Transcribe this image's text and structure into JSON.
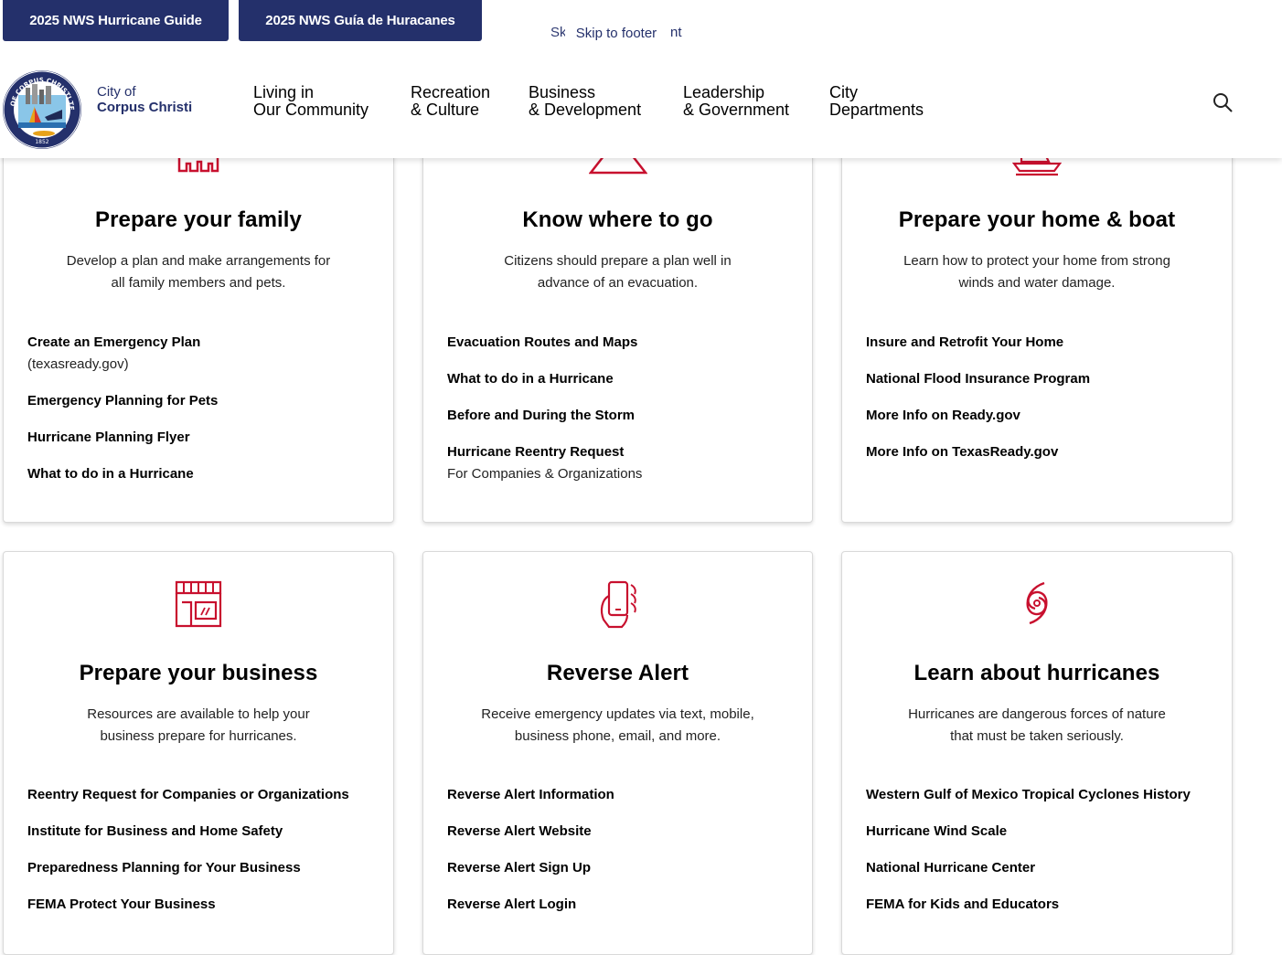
{
  "top_bar": {
    "guide_en": "2025 NWS Hurricane Guide",
    "guide_es": "2025 NWS Guía de Huracanes",
    "skip_front": "Skip to footer",
    "skip_back_left": "Sk",
    "skip_back_right": "nt"
  },
  "header": {
    "seal_text": "CITY OF CORPUS CHRISTI TEXAS",
    "seal_year": "1852",
    "brand_prefix": "City of",
    "brand_name": "Corpus Christi",
    "nav": [
      {
        "label": "Living in\nOur Community"
      },
      {
        "label": "Recreation\n& Culture"
      },
      {
        "label": "Business\n& Development"
      },
      {
        "label": "Leadership\n& Government"
      },
      {
        "label": "City\nDepartments"
      }
    ],
    "search_icon": "search-icon"
  },
  "colors": {
    "navy": "#24306b",
    "icon_red": "#c8102e"
  },
  "cards": [
    {
      "icon": "family-icon",
      "title": "Prepare your family",
      "desc": "Develop a plan and make arrangements for all family members and pets.",
      "links": [
        {
          "title": "Create an Emergency Plan",
          "sub": "(texasready.gov)"
        },
        {
          "title": "Emergency Planning for Pets",
          "sub": ""
        },
        {
          "title": "Hurricane Planning Flyer",
          "sub": ""
        },
        {
          "title": "What to do in a Hurricane",
          "sub": ""
        }
      ]
    },
    {
      "icon": "map-icon",
      "title": "Know where to go",
      "desc": "Citizens should prepare a plan well in advance of an evacuation.",
      "links": [
        {
          "title": "Evacuation Routes and Maps",
          "sub": ""
        },
        {
          "title": "What to do in a Hurricane",
          "sub": ""
        },
        {
          "title": "Before and During the Storm",
          "sub": ""
        },
        {
          "title": "Hurricane Reentry Request",
          "sub": "For Companies & Organizations"
        }
      ]
    },
    {
      "icon": "boat-icon",
      "title": "Prepare your home & boat",
      "desc": "Learn how to protect your home from strong winds and water damage.",
      "links": [
        {
          "title": "Insure and Retrofit Your Home",
          "sub": ""
        },
        {
          "title": "National Flood Insurance Program",
          "sub": ""
        },
        {
          "title": "More Info on Ready.gov",
          "sub": ""
        },
        {
          "title": "More Info on TexasReady.gov",
          "sub": ""
        }
      ]
    },
    {
      "icon": "storefront-icon",
      "title": "Prepare your business",
      "desc": "Resources are available to help your business prepare for hurricanes.",
      "links": [
        {
          "title": "Reentry Request for Companies or Organizations",
          "sub": ""
        },
        {
          "title": "Institute for Business and Home Safety",
          "sub": ""
        },
        {
          "title": "Preparedness Planning for Your Business",
          "sub": ""
        },
        {
          "title": "FEMA Protect Your Business",
          "sub": ""
        }
      ]
    },
    {
      "icon": "phone-alert-icon",
      "title": "Reverse Alert",
      "desc": "Receive emergency updates via text, mobile, business phone, email, and more.",
      "links": [
        {
          "title": "Reverse Alert Information",
          "sub": ""
        },
        {
          "title": "Reverse Alert Website",
          "sub": ""
        },
        {
          "title": "Reverse Alert Sign Up",
          "sub": ""
        },
        {
          "title": "Reverse Alert Login",
          "sub": ""
        }
      ]
    },
    {
      "icon": "hurricane-icon",
      "title": "Learn about hurricanes",
      "desc": "Hurricanes are dangerous forces of nature that must be taken seriously.",
      "links": [
        {
          "title": "Western Gulf of Mexico Tropical Cyclones History",
          "sub": ""
        },
        {
          "title": "Hurricane Wind Scale",
          "sub": ""
        },
        {
          "title": "National Hurricane Center",
          "sub": ""
        },
        {
          "title": "FEMA for Kids and Educators",
          "sub": ""
        }
      ]
    }
  ]
}
